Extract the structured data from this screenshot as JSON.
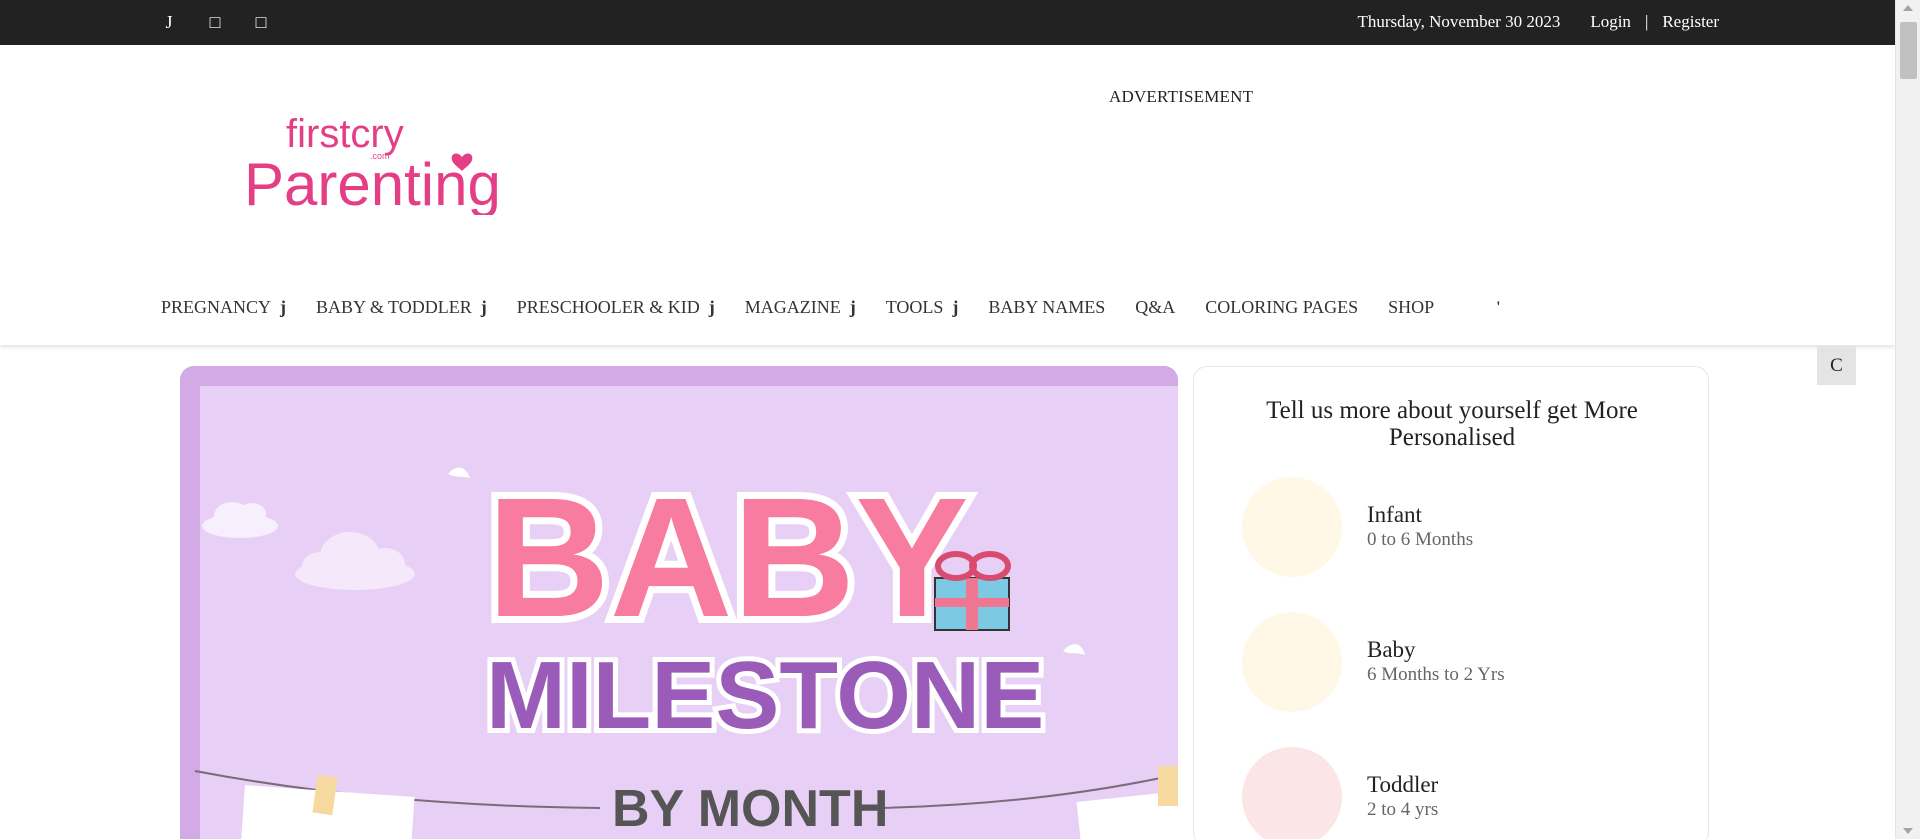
{
  "topbar": {
    "social_icons": [
      {
        "name": "facebook-icon",
        "glyph": "J"
      },
      {
        "name": "twitter-icon",
        "glyph": "□"
      },
      {
        "name": "instagram-icon",
        "glyph": "□"
      }
    ],
    "date": "Thursday, November 30 2023",
    "login": "Login",
    "separator": "|",
    "register": "Register"
  },
  "header": {
    "logo_top": "firstcry",
    "logo_com": ".com",
    "logo_main": "Parenting",
    "advertisement": "ADVERTISEMENT"
  },
  "nav": {
    "items": [
      {
        "label": "PREGNANCY",
        "caret": "j"
      },
      {
        "label": "BABY & TODDLER",
        "caret": "j"
      },
      {
        "label": "PRESCHOOLER & KID",
        "caret": "j"
      },
      {
        "label": "MAGAZINE",
        "caret": "j"
      },
      {
        "label": "TOOLS",
        "caret": "j"
      },
      {
        "label": "BABY NAMES",
        "caret": ""
      },
      {
        "label": "Q&A",
        "caret": ""
      },
      {
        "label": "COLORING PAGES",
        "caret": ""
      },
      {
        "label": "SHOP",
        "caret": ""
      }
    ],
    "extra_glyph": "'"
  },
  "float_button": "C",
  "banner": {
    "line1": "BABY",
    "line2": "MILESTONE",
    "line3": "BY MONTH"
  },
  "personalise": {
    "title": "Tell us more about yourself get More Personalised",
    "stages": [
      {
        "name": "Infant",
        "range": "0 to 6 Months",
        "color": "#fff8e6"
      },
      {
        "name": "Baby",
        "range": "6 Months to 2 Yrs",
        "color": "#fff8e6"
      },
      {
        "name": "Toddler",
        "range": "2 to 4 yrs",
        "color": "#fbe5e6"
      }
    ]
  },
  "colors": {
    "topbar_bg": "#222222",
    "brand_pink": "#e43e87",
    "banner_bg": "#e7cff6",
    "milestone_purple": "#9a5cb8"
  }
}
